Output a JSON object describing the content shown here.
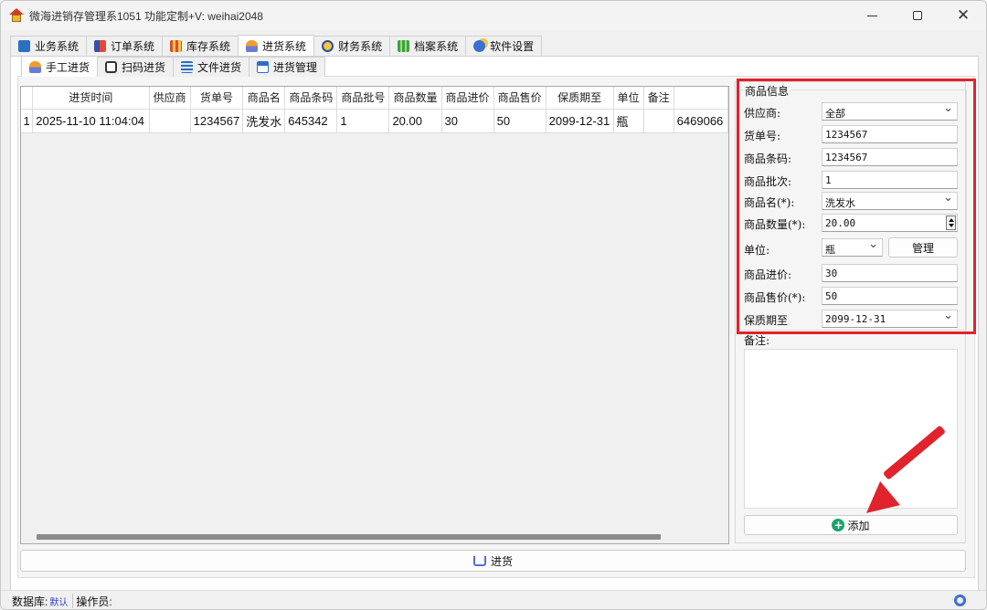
{
  "window": {
    "title": "微海进销存管理系1051  功能定制+V: weihai2048",
    "minimize": "—",
    "maximize": "▢",
    "close": "✕"
  },
  "main_tabs": [
    {
      "label": "业务系统",
      "icon": "monitor-icon"
    },
    {
      "label": "订单系统",
      "icon": "order-icon"
    },
    {
      "label": "库存系统",
      "icon": "store-icon"
    },
    {
      "label": "进货系统",
      "icon": "purchase-icon",
      "active": true
    },
    {
      "label": "财务系统",
      "icon": "finance-icon"
    },
    {
      "label": "档案系统",
      "icon": "archive-icon"
    },
    {
      "label": "软件设置",
      "icon": "settings-icon"
    }
  ],
  "sub_tabs": [
    {
      "label": "手工进货",
      "icon": "manual-icon",
      "active": true
    },
    {
      "label": "扫码进货",
      "icon": "scan-icon"
    },
    {
      "label": "文件进货",
      "icon": "file-icon"
    },
    {
      "label": "进货管理",
      "icon": "manage-icon"
    }
  ],
  "grid": {
    "columns": [
      "进货时间",
      "供应商",
      "货单号",
      "商品名",
      "商品条码",
      "商品批号",
      "商品数量",
      "商品进价",
      "商品售价",
      "保质期至",
      "单位",
      "备注",
      ""
    ],
    "rows": [
      {
        "index": "1",
        "cells": [
          "2025-11-10 11:04:04",
          "",
          "1234567",
          "洗发水",
          "645342",
          "1",
          "20.00",
          "30",
          "50",
          "2099-12-31",
          "瓶",
          "",
          "6469066"
        ]
      }
    ]
  },
  "form": {
    "group_title": "商品信息",
    "supplier_label": "供应商:",
    "supplier_value": "全部",
    "order_no_label": "货单号:",
    "order_no_value": "1234567",
    "barcode_label": "商品条码:",
    "barcode_value": "1234567",
    "batch_label": "商品批次:",
    "batch_value": "1",
    "name_label": "商品名(*):",
    "name_value": "洗发水",
    "qty_label": "商品数量(*):",
    "qty_value": "20.00",
    "unit_label": "单位:",
    "unit_value": "瓶",
    "manage_button": "管理",
    "cost_label": "商品进价:",
    "cost_value": "30",
    "price_label": "商品售价(*):",
    "price_value": "50",
    "expiry_label": "保质期至",
    "expiry_value": "2099-12-31",
    "remark_label": "备注:",
    "add_button": "添加"
  },
  "purchase_button": "进货",
  "status": {
    "db_label": "数据库:",
    "db_value": "默认",
    "operator_label": "操作员:"
  },
  "colors": {
    "highlight": "#e0232c",
    "add_icon": "#1aa56b"
  }
}
